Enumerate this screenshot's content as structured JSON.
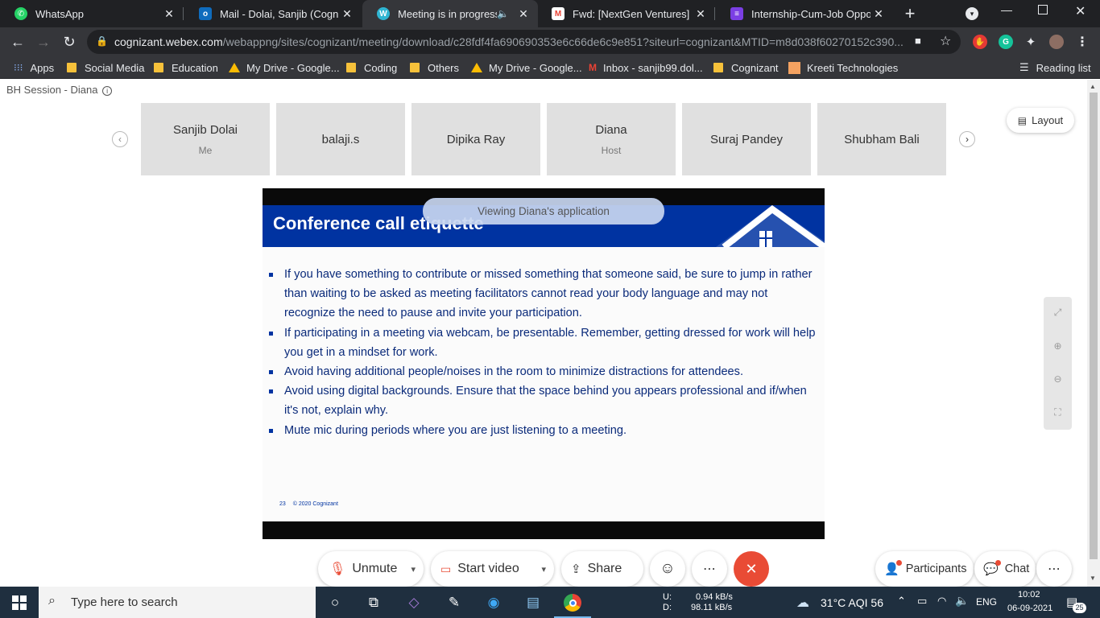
{
  "browser": {
    "tabs": [
      {
        "label": "WhatsApp",
        "icon": "whatsapp-icon",
        "color": "#25d366",
        "glyph": "✆"
      },
      {
        "label": "Mail - Dolai, Sanjib (Cognizan",
        "icon": "outlook-icon",
        "color": "#0f6cbd",
        "glyph": "o"
      },
      {
        "label": "Meeting is in progress...",
        "icon": "webex-icon",
        "color": "#2fb5d2",
        "glyph": "W",
        "active": true
      },
      {
        "label": "Fwd: [NextGen Ventures] Rec",
        "icon": "gmail-icon",
        "color": "#ea4335",
        "glyph": "M"
      },
      {
        "label": "Internship-Cum-Job Opportu",
        "icon": "forms-icon",
        "color": "#7b3fe4",
        "glyph": "≡"
      }
    ],
    "url_host": "cognizant.webex.com",
    "url_rest": "/webappng/sites/cognizant/meeting/download/c28fdf4fa690690353e6c66de6c9e851?siteurl=cognizant&MTID=m8d038f60270152c390...",
    "bookmarks": [
      {
        "label": "Apps",
        "icon": "apps-grid-icon"
      },
      {
        "label": "Social Media",
        "icon": "folder-icon"
      },
      {
        "label": "Education",
        "icon": "folder-icon"
      },
      {
        "label": "My Drive - Google...",
        "icon": "google-drive-icon"
      },
      {
        "label": "Coding",
        "icon": "folder-icon"
      },
      {
        "label": "Others",
        "icon": "folder-icon"
      },
      {
        "label": "My Drive - Google...",
        "icon": "google-drive-icon"
      },
      {
        "label": "Inbox - sanjib99.dol...",
        "icon": "gmail-icon"
      },
      {
        "label": "Cognizant",
        "icon": "folder-icon"
      },
      {
        "label": "Kreeti Technologies",
        "icon": "kreeti-icon"
      }
    ],
    "reading_list": "Reading list"
  },
  "meeting": {
    "session_title": "BH Session - Diana",
    "layout_label": "Layout",
    "participants": [
      {
        "name": "Sanjib Dolai",
        "role": "Me"
      },
      {
        "name": "balaji.s",
        "role": ""
      },
      {
        "name": "Dipika Ray",
        "role": ""
      },
      {
        "name": "Diana",
        "role": "Host"
      },
      {
        "name": "Suraj Pandey",
        "role": ""
      },
      {
        "name": "Shubham Bali",
        "role": ""
      }
    ],
    "viewing_label": "Viewing Diana's application",
    "controls": {
      "unmute": "Unmute",
      "start_video": "Start video",
      "share": "Share",
      "more": "⋯",
      "participants": "Participants",
      "chat": "Chat"
    },
    "accent_end_call": "#e94b35"
  },
  "slide": {
    "title": "Conference call etiquette",
    "bullets": [
      "If you have something to contribute or missed something that someone said, be sure to jump in rather than waiting to be asked as meeting facilitators cannot read your body language and may not recognize the need to pause and invite your participation.",
      "If participating in a meeting via webcam, be presentable. Remember, getting dressed for work will help you get in a mindset for work.",
      "Avoid having additional people/noises in the room to minimize distractions for attendees.",
      "Avoid using digital backgrounds. Ensure that the space behind you appears professional and if/when it's not, explain why.",
      "Mute mic during periods where you are just listening to a meeting."
    ],
    "page_number": "23",
    "copyright": "© 2020 Cognizant",
    "brand_color": "#0033a1"
  },
  "taskbar": {
    "search_placeholder": "Type here to search",
    "net_up_label": "U:",
    "net_up": "0.94 kB/s",
    "net_down_label": "D:",
    "net_down": "98.11 kB/s",
    "weather": "31°C  AQI 56",
    "language": "ENG",
    "time": "10:02",
    "date": "06-09-2021",
    "notifications": "25"
  }
}
